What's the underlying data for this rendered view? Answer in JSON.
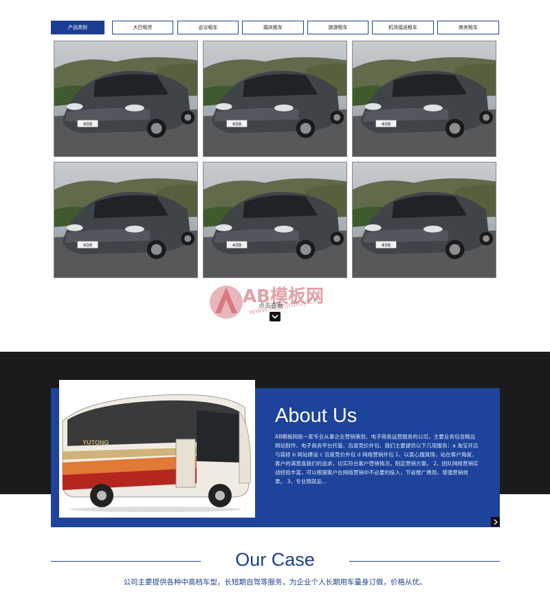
{
  "tabs": [
    {
      "label": "产品类别",
      "active": true
    },
    {
      "label": "大巴租赁",
      "active": false
    },
    {
      "label": "会议租车",
      "active": false
    },
    {
      "label": "婚庆租车",
      "active": false
    },
    {
      "label": "旅游租车",
      "active": false
    },
    {
      "label": "机场接送租车",
      "active": false
    },
    {
      "label": "商务租车",
      "active": false
    }
  ],
  "products": [
    {
      "image": "sedan-car-photo",
      "plate": "408"
    },
    {
      "image": "sedan-car-photo",
      "plate": "408"
    },
    {
      "image": "sedan-car-photo",
      "plate": "408"
    },
    {
      "image": "sedan-car-photo",
      "plate": "408"
    },
    {
      "image": "sedan-car-photo",
      "plate": "408"
    },
    {
      "image": "sedan-car-photo",
      "plate": "408"
    }
  ],
  "more": {
    "label": "点击查看",
    "icon": "chevron-down-icon"
  },
  "watermark": {
    "brand": "AB模板网",
    "url": "www.AdminBuy.Cn"
  },
  "about": {
    "title": "About Us",
    "bus_brand": "YUTONG",
    "text": "AB模板网是一家专业从事企业营销策划、电子商务运营服务的公司，主要业务包含精品网站制作、电子商务平台托管、百度竞价外包、我们主要提供以下几项服务：a 淘宝开店与装修 b 网站建设 c 百度竞价外包 d 网络营销外包 1、以真心服真情，站在客户角度，客户的满意度我们的追求，切实符合客户营销情况，制定营销方案。 2、团队网络营销实战经验丰富，可以根据客户在网络营销中不必要的投入，节省推广费用，增强营销效果。 3、专业铸就品...",
    "next_icon": "chevron-right-icon"
  },
  "case": {
    "title": "Our Case",
    "subtitle": "公司主要提供各种中高档车型，长短期自驾等服务，为企业个人长期用车量身订做，价格从优。"
  },
  "colors": {
    "primary": "#1d439a",
    "dark_band": "#1b1b1d",
    "watermark_red": "#c0323b"
  }
}
